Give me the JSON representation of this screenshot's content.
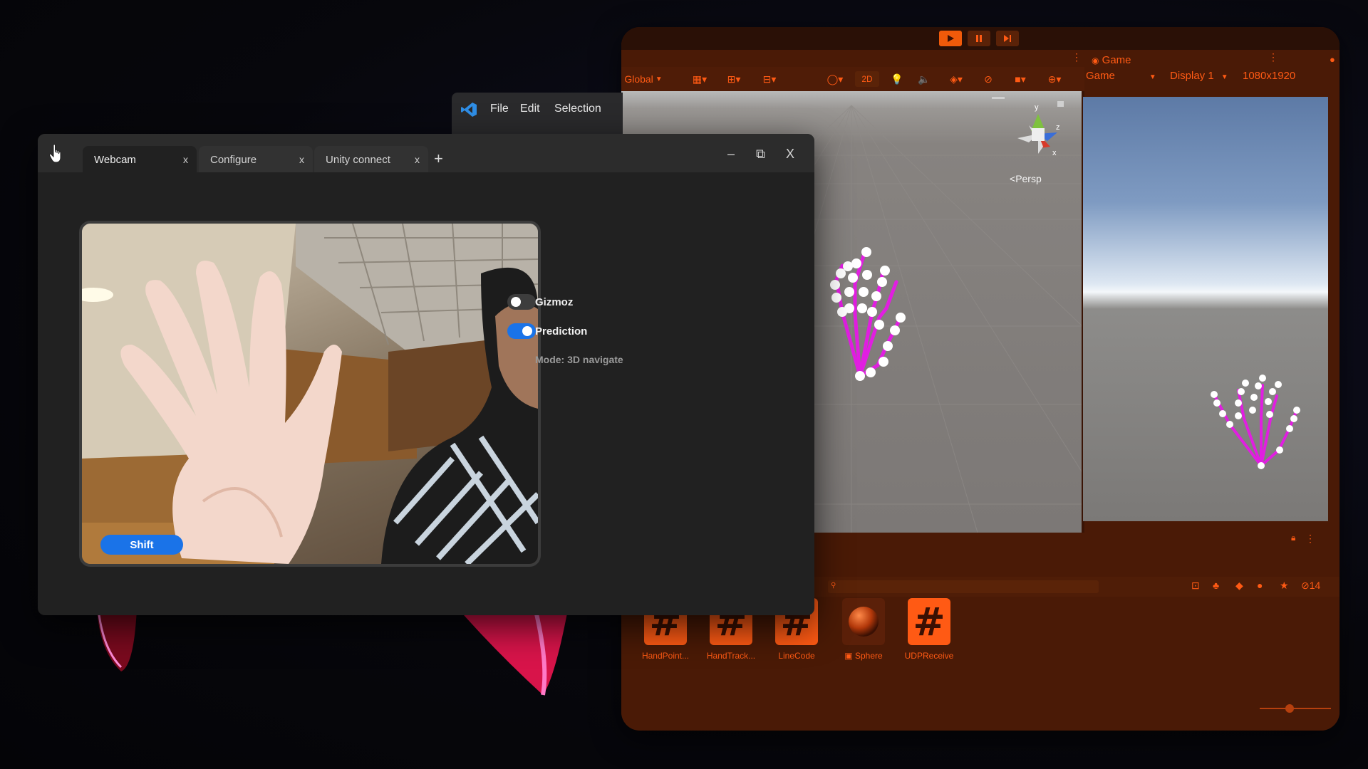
{
  "unity": {
    "game_tab": "Game",
    "global_label": "Global",
    "mode_2d": "2D",
    "persp_label": "Persp",
    "game_dropdown": "Game",
    "display_dropdown": "Display 1",
    "resolution": "1080x1920",
    "hidden_count": "14",
    "assets": [
      {
        "label": "HandPoint..."
      },
      {
        "label": "HandTrack..."
      },
      {
        "label": "LineCode"
      },
      {
        "label": "Sphere"
      },
      {
        "label": "UDPReceive"
      }
    ],
    "accent_color": "#ff5a14",
    "gizmo_axes": {
      "y": "y",
      "z": "z",
      "x": "x"
    }
  },
  "vscode": {
    "menu": [
      "File",
      "Edit",
      "Selection"
    ]
  },
  "app": {
    "tabs": [
      {
        "label": "Webcam",
        "close": "x"
      },
      {
        "label": "Configure",
        "close": "x"
      },
      {
        "label": "Unity connect",
        "close": "x"
      }
    ],
    "add_tab": "+",
    "window_controls": {
      "minimize": "–",
      "restore": "⧉",
      "close": "X"
    },
    "shift_button": "Shift",
    "options": {
      "gizmoz": {
        "label": "Gizmoz",
        "on": false
      },
      "prediction": {
        "label": "Prediction",
        "on": true
      }
    },
    "mode_text": "Mode: 3D navigate",
    "accent_color": "#1a73e8"
  }
}
